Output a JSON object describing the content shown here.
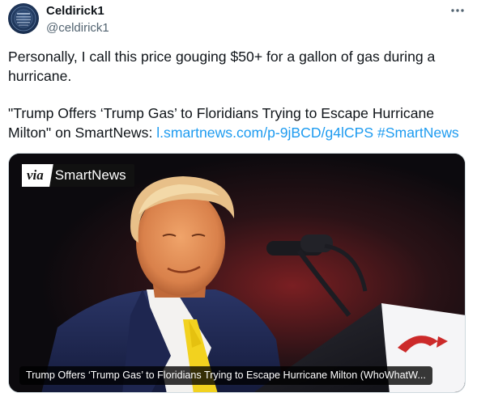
{
  "author": {
    "display_name": "Celdirick1",
    "handle": "@celdirick1",
    "avatar_icon": "avatar-image"
  },
  "more_icon": "more-dots-icon",
  "tweet": {
    "line1": "Personally, I call this price gouging $50+ for a gallon of gas during a hurricane.",
    "quote_text": " \"Trump Offers ‘Trump Gas’ to Floridians Trying to Escape Hurricane Milton\" on SmartNews: ",
    "link_url": "l.smartnews.com/p-9jBCD/g4lCPS",
    "hashtag": "#SmartNews"
  },
  "card": {
    "via_label": "via",
    "via_brand": "SmartNews",
    "caption": "Trump Offers ‘Trump Gas’ to Floridians Trying to Escape Hurricane Milton (WhoWhatW..."
  },
  "colors": {
    "link": "#1d9bf0",
    "text": "#0f1419",
    "muted": "#536471"
  }
}
